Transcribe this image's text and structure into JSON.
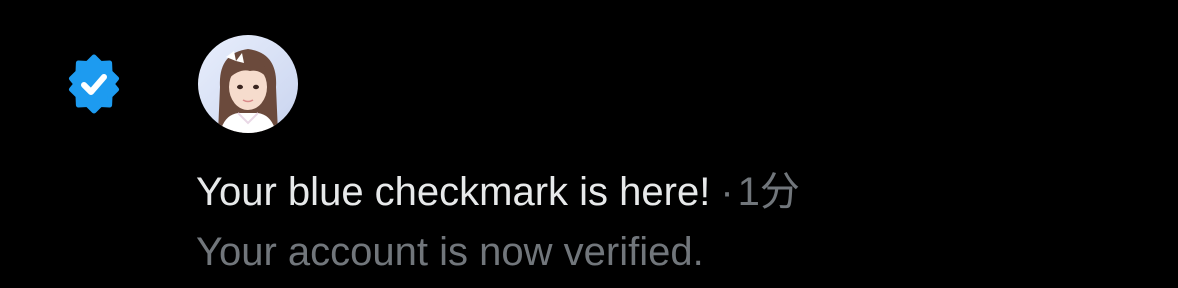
{
  "notification": {
    "icon": "verified-badge-icon",
    "accent_color": "#1d9bf0",
    "title": "Your blue checkmark is here!",
    "separator": "·",
    "time": "1分",
    "subtitle": "Your account is now verified."
  }
}
